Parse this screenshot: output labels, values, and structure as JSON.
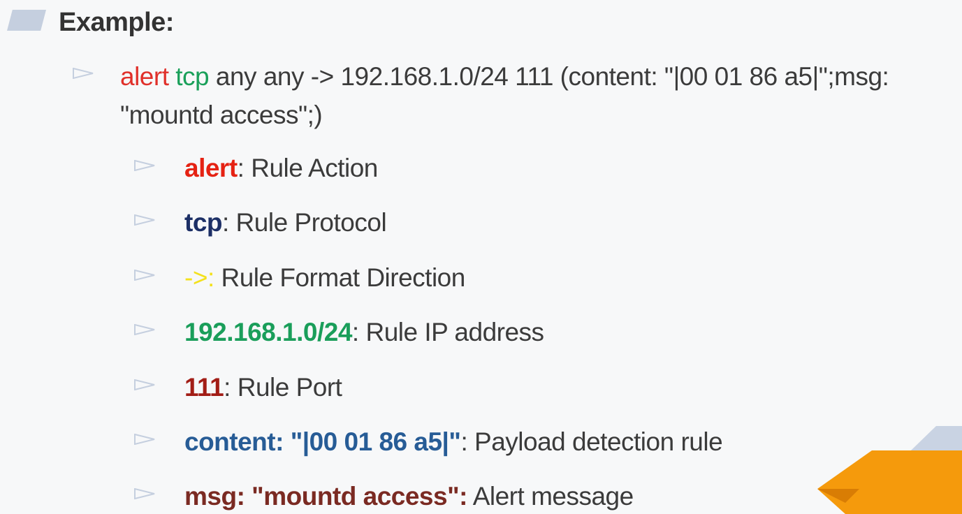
{
  "heading": {
    "text": "Example:"
  },
  "rule": {
    "action": "alert",
    "protocol": "tcp",
    "rest": " any any -> 192.168.1.0/24 111 (content: \"|00 01 86 a5|\";msg: \"mountd access\";)",
    "action_color": "#e0302a",
    "protocol_color": "#1aa05a"
  },
  "parts": [
    {
      "key": "alert",
      "sep": ":",
      "desc": " Rule Action",
      "color": "#e52213"
    },
    {
      "key": "tcp",
      "sep": ":",
      "desc": " Rule Protocol",
      "color": "#1c2f66"
    },
    {
      "key": "->",
      "sep": ":",
      "desc": " Rule Format Direction",
      "color": "#f3e11d"
    },
    {
      "key": "192.168.1.0/24",
      "sep": ":",
      "desc": " Rule IP address",
      "color": "#1a9e5a"
    },
    {
      "key": "111",
      "sep": ":",
      "desc": " Rule Port",
      "color": "#a21d16"
    },
    {
      "key": "content: \"|00 01 86 a5|\"",
      "sep": ":",
      "desc": " Payload detection rule",
      "color": "#275c96"
    },
    {
      "key": "msg: \"mountd access\"",
      "sep": ":",
      "desc": " Alert message",
      "color": "#7a2a22"
    }
  ],
  "colors": {
    "bullet": "#c5cfdf",
    "deco_blue": "#c9d3e3",
    "deco_orange": "#f59a0c",
    "deco_orange_dark": "#d97d04"
  },
  "icons": {
    "bullet": "triangle-bullet-icon",
    "title_marker": "slanted-bar-icon"
  }
}
